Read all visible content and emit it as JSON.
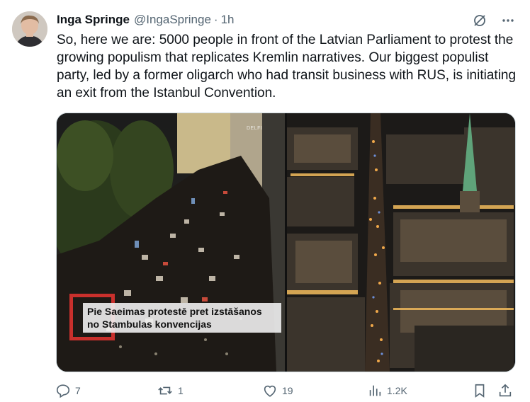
{
  "author": {
    "name": "Inga Springe",
    "handle": "@IngaSpringe",
    "separator": "·",
    "time": "1h"
  },
  "tweet": {
    "text": "So, here we are: 5000 people in front of the Latvian Parliament to protest the growing populism that replicates Kremlin narratives. Our biggest populist party, led by a former oligarch who had transit business with RUS, is initiating an exit from the Istanbul Convention."
  },
  "media": {
    "left_caption_line1": "Pie Saeimas protestē pret izstāšanos",
    "left_caption_line2": "no Stambulas konvencijas",
    "left_watermark": "DELFI"
  },
  "actions": {
    "replies": "7",
    "reposts": "1",
    "likes": "19",
    "views": "1.2K"
  },
  "icons": {
    "top": [
      "grok-icon",
      "more-icon"
    ],
    "actions": [
      "reply-icon",
      "repost-icon",
      "like-icon",
      "views-icon",
      "bookmark-icon",
      "share-icon"
    ]
  },
  "colors": {
    "text": "#0f1419",
    "secondary": "#536471",
    "caption_frame": "#c9302c"
  }
}
